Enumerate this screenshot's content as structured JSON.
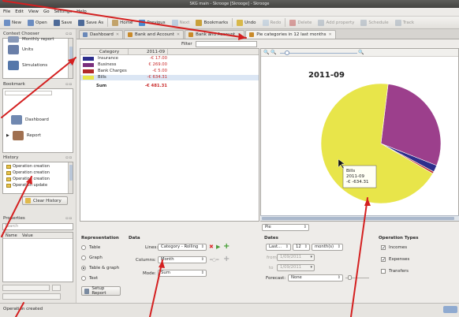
{
  "window": {
    "title": "SKG main - Skrooge [Skrooge] - Skrooge"
  },
  "menu": [
    "File",
    "Edit",
    "View",
    "Go",
    "Settings",
    "Help"
  ],
  "toolbar": [
    {
      "label": "New",
      "icon": "new-document-icon",
      "color": "#6d8fc4",
      "enabled": true
    },
    {
      "label": "Open",
      "icon": "folder-open-icon",
      "color": "#6b8cc0",
      "enabled": true
    },
    {
      "label": "Save",
      "icon": "save-icon",
      "color": "#4d6a98",
      "enabled": true
    },
    {
      "label": "Save As",
      "icon": "save-as-icon",
      "color": "#4d6a98",
      "enabled": true
    },
    {
      "label": "Home",
      "icon": "home-icon",
      "color": "#c2a36a",
      "enabled": true
    },
    {
      "label": "Previous",
      "icon": "arrow-left-icon",
      "color": "#4a8ad0",
      "enabled": true
    },
    {
      "label": "Next",
      "icon": "arrow-right-icon",
      "color": "#8fb1d8",
      "enabled": false
    },
    {
      "label": "Bookmarks",
      "icon": "bookmark-icon",
      "color": "#c9a13a",
      "enabled": true
    },
    {
      "label": "Undo",
      "icon": "undo-icon",
      "color": "#d8b84a",
      "enabled": true
    },
    {
      "label": "Redo",
      "icon": "redo-icon",
      "color": "#a8c0d8",
      "enabled": false
    },
    {
      "label": "Delete",
      "icon": "delete-icon",
      "color": "#c05050",
      "enabled": false
    },
    {
      "label": "Add property",
      "icon": "pen-icon",
      "color": "#9aa7b8",
      "enabled": false
    },
    {
      "label": "Schedule",
      "icon": "schedule-icon",
      "color": "#9aa7b8",
      "enabled": false
    },
    {
      "label": "Track",
      "icon": "track-icon",
      "color": "#9aa7b8",
      "enabled": false
    }
  ],
  "context_chooser": {
    "title": "Context Chooser",
    "items": [
      {
        "label": "Monthly report",
        "color": "#8a9ab8"
      },
      {
        "label": "Units",
        "color": "#6a7fa8"
      },
      {
        "label": "Simulations",
        "color": "#5577aa"
      }
    ]
  },
  "bookmark": {
    "title": "Bookmark",
    "items": [
      {
        "label": "Dashboard",
        "color": "#7088b0"
      },
      {
        "label": "Report",
        "color": "#a07050"
      }
    ]
  },
  "history": {
    "title": "History",
    "items": [
      "Operation creation",
      "Operation creation",
      "Operation creation",
      "Operation update"
    ],
    "clear_button": "Clear History"
  },
  "properties": {
    "title": "Properties",
    "search_placeholder": "Search",
    "columns": [
      "Name",
      "Value"
    ]
  },
  "tabs": [
    {
      "label": "Dashboard",
      "icon": "dashboard-icon",
      "active": false
    },
    {
      "label": "Bank and Account",
      "icon": "bank-icon",
      "active": false
    },
    {
      "label": "Bank and Account",
      "icon": "bank-icon",
      "active": false
    },
    {
      "label": "Pie categories in 12 last months",
      "icon": "pie-chart-icon",
      "active": true
    }
  ],
  "filter_label": "Filter",
  "report_table": {
    "columns": [
      "Category",
      "2011-09"
    ],
    "rows": [
      {
        "category": "Insurance",
        "value": "-€ 17.00",
        "color": "#2d2e8c"
      },
      {
        "category": "Business",
        "value": "€ 269.00",
        "color": "#7a2f7c"
      },
      {
        "category": "Bank Charges",
        "value": "-€ 5.00",
        "color": "#b22a2a"
      },
      {
        "category": "Bills",
        "value": "-€ 634.31",
        "color": "#e8e54a"
      }
    ],
    "sum_label": "Sum",
    "sum_value": "-€ 481.31"
  },
  "chart_data": {
    "type": "pie",
    "title": "2011-09",
    "categories": [
      "Insurance",
      "Business",
      "Bank Charges",
      "Bills"
    ],
    "values": [
      17.0,
      269.0,
      5.0,
      634.31
    ],
    "colors": [
      "#2d2e8c",
      "#9c3f8c",
      "#c03434",
      "#e8e54a"
    ],
    "tooltip": [
      "Bills",
      "2011-09",
      "-€ -634.31"
    ],
    "legend": "none"
  },
  "chart_type_combo": "Pie",
  "representation": {
    "title": "Representation",
    "options": [
      "Table",
      "Graph",
      "Table & graph",
      "Text"
    ],
    "selected": 2,
    "setup_button": "Setup Report"
  },
  "data": {
    "title": "Data",
    "lines_label": "Lines:",
    "lines_value": "Category - Rolling",
    "columns_label": "Columns:",
    "columns_value": "Month",
    "mode_label": "Mode:",
    "mode_value": "Sum"
  },
  "dates": {
    "title": "Dates",
    "period": "Last...",
    "count": "12",
    "unit": "month(s)",
    "from_label": "from",
    "from_value": "1/09/2011",
    "to_label": "to",
    "to_value": "1/09/2011",
    "forecast_label": "Forecast:",
    "forecast_value": "None"
  },
  "operation_types": {
    "title": "Operation Types",
    "options": [
      {
        "label": "Incomes",
        "checked": true
      },
      {
        "label": "Expenses",
        "checked": true
      },
      {
        "label": "Transfers",
        "checked": false
      }
    ]
  },
  "status": {
    "message": "Operation created"
  }
}
